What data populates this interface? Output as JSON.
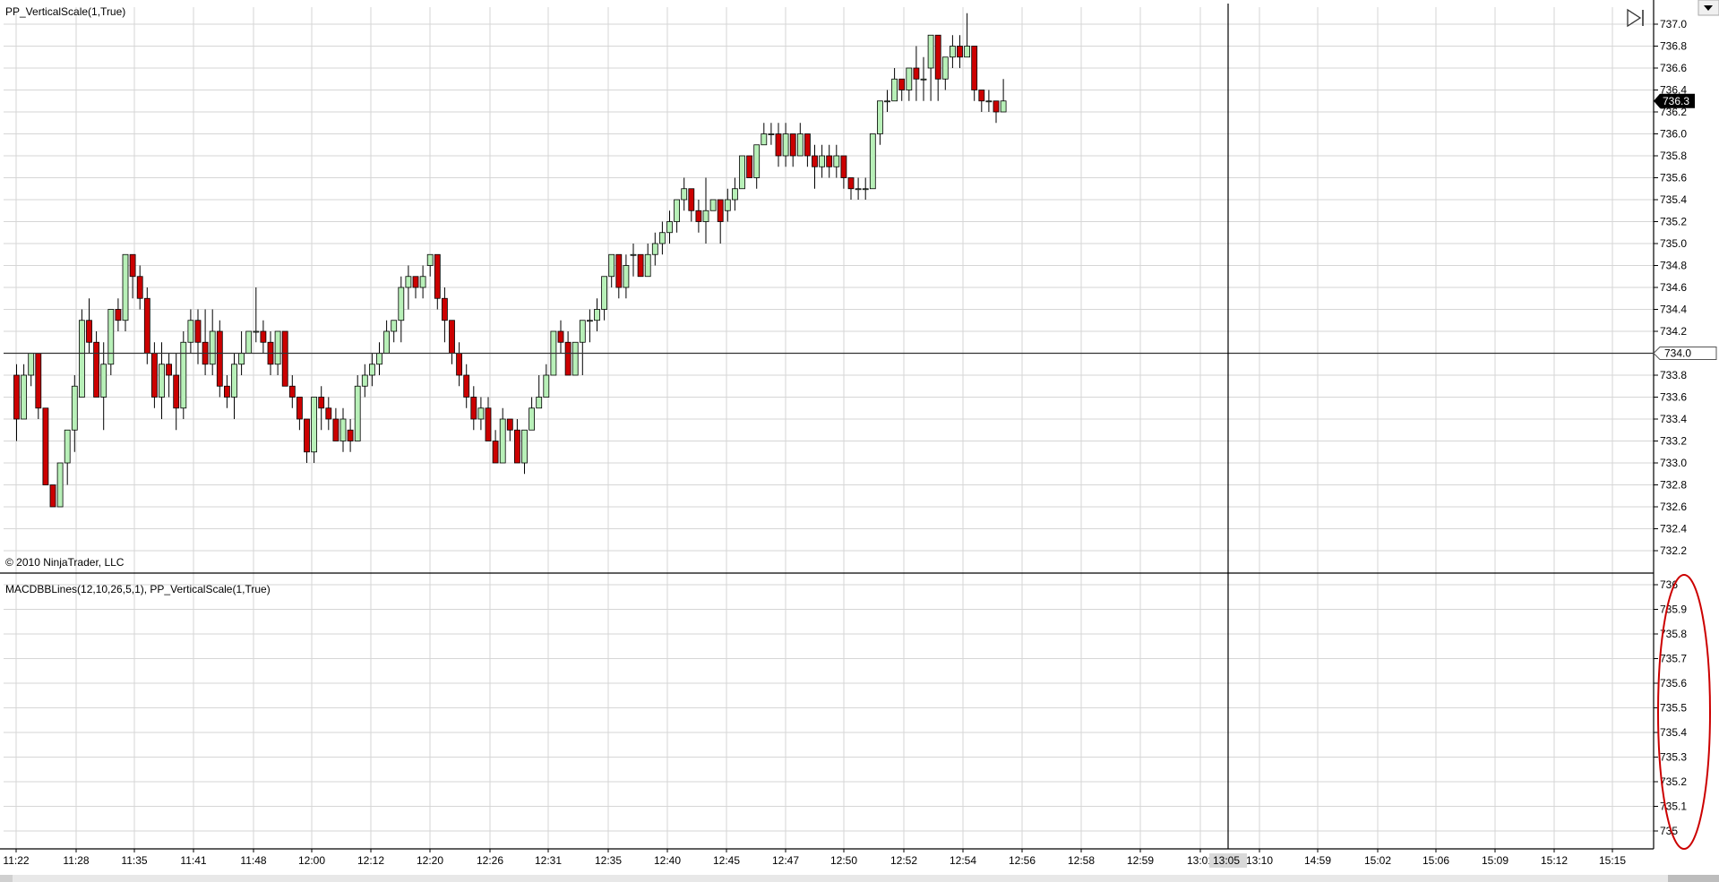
{
  "indicator_label": "PP_VerticalScale(1,True)",
  "copyright": "© 2010 NinjaTrader, LLC",
  "lower_panel_label": "MACDBBLines(12,10,26,5,1),  PP_VerticalScale(1,True)",
  "price_marker": "736.3",
  "line_marker": "734.0",
  "crosshair_time": "13:05",
  "colors": {
    "up": "#b8f0b8",
    "down": "#cc0000",
    "grid": "#d6d6d6",
    "annotation": "#cc0000",
    "marker_bg": "#000000"
  },
  "icons": [
    "play-end-icon",
    "scroll-down-icon"
  ],
  "chart_data": [
    {
      "type": "candlestick",
      "title": "",
      "ylim": [
        732.0,
        737.1
      ],
      "y_ticks": [
        "737.0",
        "736.8",
        "736.6",
        "736.4",
        "736.2",
        "736.0",
        "735.8",
        "735.6",
        "735.4",
        "735.2",
        "735.0",
        "734.8",
        "734.6",
        "734.4",
        "734.2",
        "734.0",
        "733.8",
        "733.6",
        "733.4",
        "733.2",
        "733.0",
        "732.8",
        "732.6",
        "732.4",
        "732.2"
      ],
      "x_labels": [
        "11:22",
        "11:28",
        "11:35",
        "11:41",
        "11:48",
        "12:00",
        "12:12",
        "12:20",
        "12:26",
        "12:31",
        "12:35",
        "12:40",
        "12:45",
        "12:47",
        "12:50",
        "12:52",
        "12:54",
        "12:56",
        "12:58",
        "12:59",
        "13:01",
        "13:10",
        "14:59",
        "15:02",
        "15:06",
        "15:09",
        "15:12",
        "15:15"
      ],
      "horizontal_line": 734.0,
      "last_price": 736.3,
      "candles": [
        [
          733.8,
          733.4,
          733.9,
          733.2
        ],
        [
          733.4,
          733.8,
          733.9,
          733.4
        ],
        [
          733.8,
          734.0,
          734.0,
          733.7
        ],
        [
          734.0,
          733.5,
          734.0,
          733.4
        ],
        [
          733.5,
          732.8,
          733.5,
          732.8
        ],
        [
          732.8,
          732.6,
          732.8,
          732.6
        ],
        [
          732.6,
          733.0,
          733.0,
          732.6
        ],
        [
          733.0,
          733.3,
          733.3,
          732.8
        ],
        [
          733.3,
          733.7,
          733.8,
          733.1
        ],
        [
          733.6,
          734.3,
          734.4,
          733.6
        ],
        [
          734.3,
          734.1,
          734.5,
          734.0
        ],
        [
          734.1,
          733.6,
          734.2,
          733.6
        ],
        [
          733.6,
          733.9,
          734.1,
          733.3
        ],
        [
          733.9,
          734.4,
          734.4,
          733.8
        ],
        [
          734.4,
          734.3,
          734.5,
          734.2
        ],
        [
          734.3,
          734.9,
          734.9,
          734.2
        ],
        [
          734.9,
          734.7,
          734.9,
          734.5
        ],
        [
          734.7,
          734.5,
          734.8,
          734.4
        ],
        [
          734.5,
          734.0,
          734.6,
          733.9
        ],
        [
          734.0,
          733.6,
          734.1,
          733.5
        ],
        [
          733.6,
          733.9,
          734.1,
          733.4
        ],
        [
          733.9,
          733.8,
          734.0,
          733.6
        ],
        [
          733.8,
          733.5,
          734.0,
          733.3
        ],
        [
          733.5,
          734.1,
          734.2,
          733.4
        ],
        [
          734.1,
          734.3,
          734.4,
          734.0
        ],
        [
          734.3,
          734.1,
          734.4,
          733.9
        ],
        [
          734.1,
          733.9,
          734.4,
          733.8
        ],
        [
          733.9,
          734.2,
          734.4,
          733.8
        ],
        [
          734.2,
          733.7,
          734.3,
          733.6
        ],
        [
          733.7,
          733.6,
          733.8,
          733.5
        ],
        [
          733.6,
          733.9,
          734.0,
          733.4
        ],
        [
          733.9,
          734.0,
          734.2,
          733.8
        ],
        [
          734.0,
          734.2,
          734.2,
          734.0
        ],
        [
          734.2,
          734.2,
          734.6,
          734.1
        ],
        [
          734.2,
          734.1,
          734.3,
          734.0
        ],
        [
          734.1,
          733.9,
          734.2,
          733.8
        ],
        [
          733.9,
          734.2,
          734.2,
          733.8
        ],
        [
          734.2,
          733.7,
          734.2,
          733.7
        ],
        [
          733.7,
          733.6,
          733.8,
          733.5
        ],
        [
          733.6,
          733.4,
          733.6,
          733.3
        ],
        [
          733.4,
          733.1,
          733.4,
          733.0
        ],
        [
          733.1,
          733.6,
          733.6,
          733.0
        ],
        [
          733.6,
          733.5,
          733.7,
          733.3
        ],
        [
          733.5,
          733.4,
          733.6,
          733.3
        ],
        [
          733.4,
          733.2,
          733.5,
          733.2
        ],
        [
          733.2,
          733.4,
          733.5,
          733.1
        ],
        [
          733.3,
          733.2,
          733.4,
          733.1
        ],
        [
          733.2,
          733.7,
          733.8,
          733.2
        ],
        [
          733.7,
          733.8,
          733.9,
          733.6
        ],
        [
          733.8,
          733.9,
          734.0,
          733.7
        ],
        [
          733.9,
          734.0,
          734.1,
          733.8
        ],
        [
          734.0,
          734.2,
          734.3,
          734.0
        ],
        [
          734.2,
          734.3,
          734.3,
          734.1
        ],
        [
          734.3,
          734.6,
          734.7,
          734.1
        ],
        [
          734.6,
          734.7,
          734.8,
          734.4
        ],
        [
          734.7,
          734.6,
          734.7,
          734.5
        ],
        [
          734.6,
          734.7,
          734.8,
          734.5
        ],
        [
          734.8,
          734.9,
          734.9,
          734.7
        ],
        [
          734.9,
          734.5,
          734.9,
          734.4
        ],
        [
          734.5,
          734.3,
          734.6,
          734.1
        ],
        [
          734.3,
          734.0,
          734.3,
          733.9
        ],
        [
          734.0,
          733.8,
          734.1,
          733.7
        ],
        [
          733.8,
          733.6,
          733.9,
          733.5
        ],
        [
          733.6,
          733.4,
          733.7,
          733.3
        ],
        [
          733.4,
          733.5,
          733.6,
          733.3
        ],
        [
          733.5,
          733.2,
          733.6,
          733.2
        ],
        [
          733.2,
          733.0,
          733.3,
          733.0
        ],
        [
          733.0,
          733.4,
          733.5,
          733.0
        ],
        [
          733.4,
          733.3,
          733.4,
          733.2
        ],
        [
          733.3,
          733.0,
          733.4,
          733.0
        ],
        [
          733.0,
          733.3,
          733.3,
          732.9
        ],
        [
          733.3,
          733.5,
          733.6,
          733.3
        ],
        [
          733.5,
          733.6,
          733.8,
          733.5
        ],
        [
          733.6,
          733.8,
          733.9,
          733.6
        ],
        [
          733.8,
          734.2,
          734.2,
          733.8
        ],
        [
          734.2,
          734.1,
          734.3,
          734.0
        ],
        [
          734.1,
          733.8,
          734.2,
          733.8
        ],
        [
          733.8,
          734.1,
          734.1,
          733.8
        ],
        [
          734.1,
          734.3,
          734.3,
          733.8
        ],
        [
          734.3,
          734.3,
          734.4,
          734.1
        ],
        [
          734.3,
          734.4,
          734.5,
          734.2
        ],
        [
          734.4,
          734.7,
          734.7,
          734.3
        ],
        [
          734.7,
          734.9,
          734.9,
          734.6
        ],
        [
          734.9,
          734.6,
          734.9,
          734.5
        ],
        [
          734.6,
          734.8,
          734.9,
          734.5
        ],
        [
          734.9,
          734.9,
          735.0,
          734.7
        ],
        [
          734.9,
          734.7,
          734.9,
          734.7
        ],
        [
          734.7,
          734.9,
          735.0,
          734.7
        ],
        [
          734.9,
          735.0,
          735.1,
          734.8
        ],
        [
          735.0,
          735.1,
          735.2,
          734.9
        ],
        [
          735.1,
          735.2,
          735.3,
          735.0
        ],
        [
          735.2,
          735.4,
          735.4,
          735.1
        ],
        [
          735.4,
          735.5,
          735.6,
          735.3
        ],
        [
          735.5,
          735.3,
          735.5,
          735.2
        ],
        [
          735.3,
          735.2,
          735.4,
          735.1
        ],
        [
          735.2,
          735.3,
          735.6,
          735.0
        ],
        [
          735.3,
          735.4,
          735.4,
          735.3
        ],
        [
          735.4,
          735.2,
          735.4,
          735.0
        ],
        [
          735.3,
          735.4,
          735.5,
          735.2
        ],
        [
          735.4,
          735.5,
          735.6,
          735.3
        ],
        [
          735.5,
          735.8,
          735.8,
          735.5
        ],
        [
          735.8,
          735.6,
          735.8,
          735.6
        ],
        [
          735.6,
          735.9,
          735.9,
          735.5
        ],
        [
          735.9,
          736.0,
          736.1,
          735.9
        ],
        [
          736.0,
          736.0,
          736.1,
          735.9
        ],
        [
          736.0,
          735.8,
          736.1,
          735.7
        ],
        [
          735.8,
          736.0,
          736.1,
          735.7
        ],
        [
          736.0,
          735.8,
          736.0,
          735.7
        ],
        [
          735.8,
          736.0,
          736.1,
          735.8
        ],
        [
          736.0,
          735.8,
          736.0,
          735.7
        ],
        [
          735.8,
          735.7,
          735.9,
          735.5
        ],
        [
          735.7,
          735.8,
          735.9,
          735.6
        ],
        [
          735.8,
          735.7,
          735.9,
          735.6
        ],
        [
          735.7,
          735.8,
          735.9,
          735.6
        ],
        [
          735.8,
          735.6,
          735.8,
          735.5
        ],
        [
          735.6,
          735.5,
          735.6,
          735.4
        ],
        [
          735.5,
          735.5,
          735.6,
          735.4
        ],
        [
          735.5,
          735.5,
          735.6,
          735.4
        ],
        [
          735.5,
          736.0,
          736.0,
          735.5
        ],
        [
          736.0,
          736.3,
          736.3,
          735.9
        ],
        [
          736.3,
          736.3,
          736.4,
          736.2
        ],
        [
          736.3,
          736.5,
          736.6,
          736.3
        ],
        [
          736.5,
          736.4,
          736.5,
          736.3
        ],
        [
          736.4,
          736.6,
          736.6,
          736.3
        ],
        [
          736.6,
          736.5,
          736.8,
          736.3
        ],
        [
          736.5,
          736.5,
          736.7,
          736.3
        ],
        [
          736.6,
          736.9,
          736.9,
          736.3
        ],
        [
          736.9,
          736.5,
          736.9,
          736.3
        ],
        [
          736.5,
          736.7,
          736.7,
          736.4
        ],
        [
          736.7,
          736.8,
          736.9,
          736.6
        ],
        [
          736.8,
          736.7,
          736.9,
          736.6
        ],
        [
          736.7,
          736.8,
          737.1,
          736.7
        ],
        [
          736.8,
          736.4,
          736.8,
          736.3
        ],
        [
          736.4,
          736.3,
          736.4,
          736.2
        ],
        [
          736.3,
          736.3,
          736.4,
          736.2
        ],
        [
          736.3,
          736.2,
          736.3,
          736.1
        ],
        [
          736.2,
          736.3,
          736.5,
          736.2
        ]
      ]
    },
    {
      "type": "line",
      "title": "",
      "ylim": [
        735.0,
        736.0
      ],
      "y_ticks": [
        "736",
        "735.9",
        "735.8",
        "735.7",
        "735.6",
        "735.5",
        "735.4",
        "735.3",
        "735.2",
        "735.1",
        "735"
      ],
      "series": []
    }
  ]
}
